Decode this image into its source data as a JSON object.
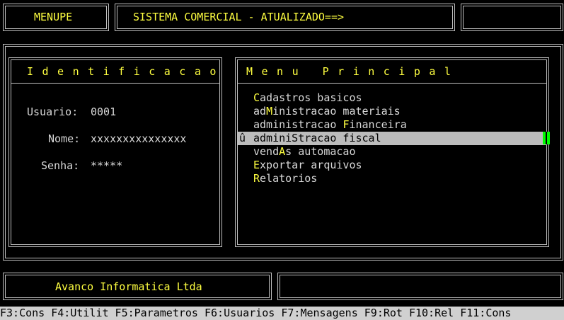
{
  "header": {
    "module": "MENUPE",
    "title": "SISTEMA COMERCIAL - ATUALIZADO==>",
    "right": ""
  },
  "identification": {
    "title": "Identificacao",
    "user_label": "Usuario:",
    "user_value": "0001",
    "name_label": "Nome:",
    "name_value": "xxxxxxxxxxxxxxx",
    "password_label": "Senha:",
    "password_value": "*****"
  },
  "menu": {
    "title": "Menu Principal",
    "selected_marker": "û",
    "items": [
      {
        "pre": "",
        "key": "C",
        "post": "adastros basicos",
        "selected": false
      },
      {
        "pre": "ad",
        "key": "M",
        "post": "inistracao materiais",
        "selected": false
      },
      {
        "pre": "administracao ",
        "key": "F",
        "post": "inanceira",
        "selected": false
      },
      {
        "pre": "adminiS",
        "key": "",
        "post": "tracao fiscal",
        "selected": true
      },
      {
        "pre": "vend",
        "key": "A",
        "post": "s automacao",
        "selected": false
      },
      {
        "pre": "",
        "key": "E",
        "post": "xportar arquivos",
        "selected": false
      },
      {
        "pre": "",
        "key": "R",
        "post": "elatorios",
        "selected": false
      }
    ]
  },
  "footer": {
    "company": "Avanco Informatica Ltda",
    "right": ""
  },
  "function_keys": "F3:Cons F4:Utilit F5:Parametros F6:Usuarios F7:Mensagens F9:Rot F10:Rel F11:Cons",
  "colors": {
    "background": "#000000",
    "highlight_text": "#ffff40",
    "normal_text": "#d8d8d8",
    "selection_bar": "#bcbcbc",
    "cursor": "#00ff00"
  }
}
